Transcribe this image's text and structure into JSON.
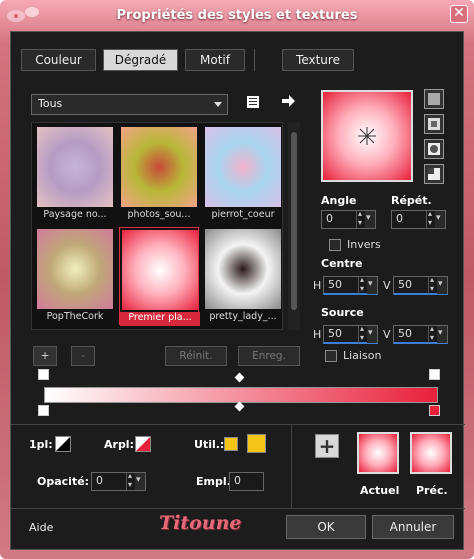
{
  "window": {
    "title": "Propriétés des styles et textures",
    "close": "✕"
  },
  "tabs": [
    {
      "label": "Couleur"
    },
    {
      "label": "Dégradé"
    },
    {
      "label": "Motif"
    },
    {
      "label": "Texture"
    }
  ],
  "category": {
    "selected": "Tous"
  },
  "gallery": [
    {
      "name": "Paysage no...",
      "colors": [
        "#c6b6d8",
        "#b59cc4",
        "#e4c2c2"
      ]
    },
    {
      "name": "photos_sou...",
      "colors": [
        "#c94a3a",
        "#b8b838",
        "#f2a288"
      ]
    },
    {
      "name": "pierrot_coeur",
      "colors": [
        "#f3b2cc",
        "#a8d6f0",
        "#d8c0e6"
      ]
    },
    {
      "name": "PopTheCork",
      "colors": [
        "#f0f0c0",
        "#c0a878",
        "#d07a9c"
      ]
    },
    {
      "name": "Premier pla...",
      "colors": [
        "#ffffff",
        "#ffb0bc",
        "#e8203c"
      ]
    },
    {
      "name": "pretty_lady_...",
      "colors": [
        "#2a1a1a",
        "#f4f4f4",
        "#8a8a8a"
      ]
    }
  ],
  "buttons": {
    "add": "+",
    "remove": "-",
    "reset": "Réinit.",
    "save": "Enreg."
  },
  "angle": {
    "label": "Angle",
    "value": "0"
  },
  "repeat": {
    "label": "Répét.",
    "value": "0"
  },
  "invert": {
    "label": "Invers"
  },
  "center": {
    "label": "Centre",
    "h_label": "H",
    "h": "50",
    "v_label": "V",
    "v": "50"
  },
  "source": {
    "label": "Source",
    "h_label": "H",
    "h": "50",
    "v_label": "V",
    "v": "50"
  },
  "link": {
    "label": "Liaison"
  },
  "lower": {
    "fg_label": "1pl:",
    "bg_label": "Arpl:",
    "user_label": "Util.:",
    "opacity_label": "Opacité:",
    "opacity_value": "0",
    "location_label": "Empl.:",
    "location_value": "0"
  },
  "swatches": {
    "current": "Actuel",
    "previous": "Préc."
  },
  "footer": {
    "help": "Aide",
    "ok": "OK",
    "cancel": "Annuler",
    "logo": "Titoune"
  },
  "colors": {
    "accent": "#e8203c",
    "light": "#ffffff",
    "user": "#f5c518"
  }
}
